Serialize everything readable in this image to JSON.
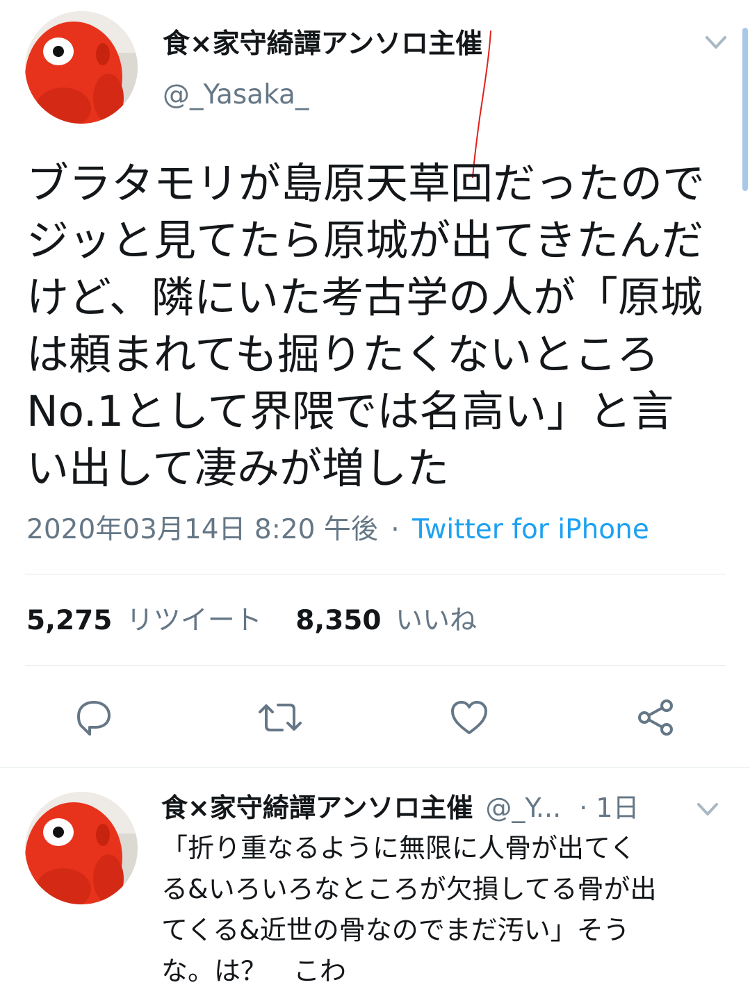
{
  "tweet": {
    "display_name": "食×家守綺譚アンソロ主催",
    "handle": "@_Yasaka_",
    "text_lines": [
      "ブラタモリが島原天草回だったので",
      "ジッと見てたら原城が出てきたんだ",
      "けど、隣にいた考古学の人が「原城",
      "は頼まれても掘りたくないところ",
      "No.1として界隈では名高い」と言",
      "い出して凄みが増した"
    ],
    "timestamp": "2020年03月14日 8:20 午後",
    "separator": "·",
    "source": "Twitter for iPhone",
    "retweets_count": "5,275",
    "retweets_label": "リツイート",
    "likes_count": "8,350",
    "likes_label": "いいね"
  },
  "actions": {
    "reply_icon": "reply-icon",
    "retweet_icon": "retweet-icon",
    "like_icon": "heart-icon",
    "share_icon": "share-icon"
  },
  "reply": {
    "display_name": "食×家守綺譚アンソロ主催",
    "handle": "@_Y...",
    "age": "· 1日",
    "text_lines": [
      "「折り重なるように無限に人骨が出てく",
      "る&いろいろなところが欠損してる骨が出",
      "てくる&近世の骨なのでまだ汚い」そう",
      "な。は？　こわ"
    ]
  },
  "colors": {
    "link": "#1da1f2",
    "text": "#14171a",
    "muted": "#657786",
    "divider": "#e1e8ed",
    "avatar_red": "#e8331c"
  }
}
